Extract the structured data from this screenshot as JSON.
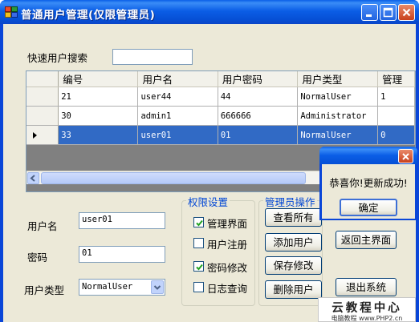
{
  "window": {
    "title": "普通用户管理(仅限管理员)",
    "colors": {
      "titlebar": "#0a5ee8",
      "selection": "#316ac5",
      "group_title": "#0046d5"
    }
  },
  "search": {
    "label": "快速用户搜索",
    "value": ""
  },
  "grid": {
    "columns": [
      "编号",
      "用户名",
      "用户密码",
      "用户类型",
      "管理"
    ],
    "rows": [
      {
        "id": "21",
        "username": "user44",
        "password": "44",
        "type": "NormalUser",
        "manage": "1",
        "selected": false
      },
      {
        "id": "30",
        "username": "admin1",
        "password": "666666",
        "type": "Administrator",
        "manage": "",
        "selected": false
      },
      {
        "id": "33",
        "username": "user01",
        "password": "01",
        "type": "NormalUser",
        "manage": "0",
        "selected": true
      }
    ],
    "current_row_icon": "row-pointer-icon"
  },
  "form": {
    "username_label": "用户名",
    "username_value": "user01",
    "password_label": "密码",
    "password_value": "01",
    "usertype_label": "用户类型",
    "usertype_value": "NormalUser"
  },
  "permissions": {
    "title": "权限设置",
    "items": [
      {
        "label": "管理界面",
        "checked": true
      },
      {
        "label": "用户注册",
        "checked": false
      },
      {
        "label": "密码修改",
        "checked": true
      },
      {
        "label": "日志查询",
        "checked": false
      }
    ]
  },
  "admin_ops": {
    "title": "管理员操作",
    "buttons": [
      "查看所有",
      "添加用户",
      "保存修改",
      "删除用户"
    ]
  },
  "side_buttons": {
    "return_main": "返回主界面",
    "exit": "退出系统"
  },
  "messagebox": {
    "text": "恭喜你!更新成功!",
    "ok": "确定"
  },
  "watermark": {
    "line1": "云教程中心",
    "line2": "电脑教程 www.PHP2.cn"
  }
}
